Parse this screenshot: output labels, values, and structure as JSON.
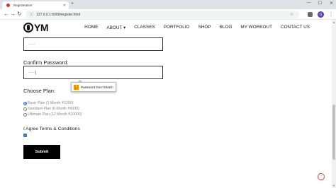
{
  "browser": {
    "tab_title": "Registeration",
    "new_tab": "+",
    "url": "127.0.0.1:5000/register.html",
    "avatar_letter": "G"
  },
  "site": {
    "logo_text": "YM",
    "nav": [
      "HOME",
      "ABOUT ▾",
      "CLASSES",
      "PORTFOLIO",
      "SHOP",
      "BLOG",
      "MY WORKOUT",
      "CONTACT US"
    ]
  },
  "form": {
    "password_value": "·····",
    "confirm_label": "Confirm Password:",
    "confirm_value": "·····|",
    "tooltip": "Password Don't Match",
    "plan_label": "Choose Plan:",
    "plans": [
      {
        "label": "Basic Plan (1 Month ₹1200)",
        "selected": true
      },
      {
        "label": "Standard Plan (6 Month ₹6000)",
        "selected": false
      },
      {
        "label": "Ultimate Plan (12 Month ₹10000)",
        "selected": false
      }
    ],
    "terms_label": "I Agree Terms & Conditions",
    "terms_checked": true,
    "submit_label": "Submit"
  },
  "colors": {
    "accent": "#1a73e8",
    "back_to_top": "#e53935",
    "button_bg": "#000000"
  }
}
